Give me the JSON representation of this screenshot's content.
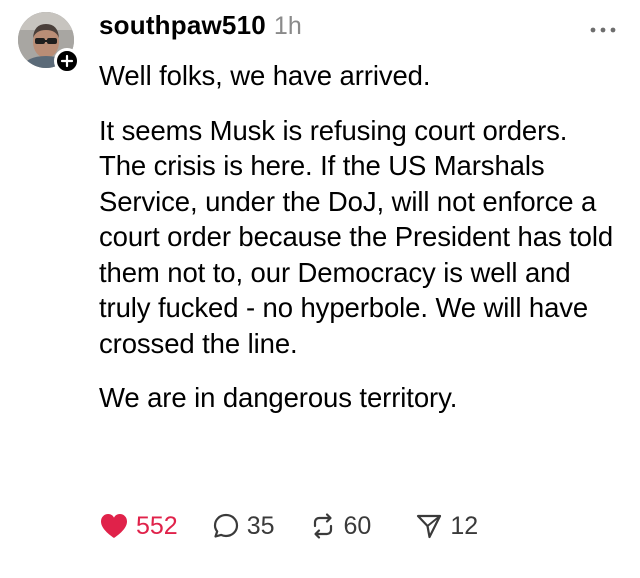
{
  "post": {
    "username": "southpaw510",
    "timestamp": "1h",
    "paragraphs": [
      "Well folks, we have arrived.",
      "It seems Musk is refusing court orders. The crisis is here. If the US Marshals Service, under the DoJ, will not enforce a court order because the President has told them not to, our Democracy is well and truly fucked - no hyperbole.  We will have crossed the line.",
      "We are in dangerous territory."
    ],
    "stats": {
      "likes": "552",
      "replies": "35",
      "reposts": "60",
      "shares": "12"
    },
    "liked": true
  },
  "icons": {
    "avatar": "profile-photo",
    "follow": "plus-icon",
    "more": "ellipsis-icon",
    "like": "heart-icon",
    "reply": "speech-bubble-icon",
    "repost": "repost-arrows-icon",
    "share": "send-icon"
  },
  "colors": {
    "text": "#000000",
    "muted": "#8a8a8a",
    "like_active": "#e0224a",
    "background": "#ffffff"
  }
}
